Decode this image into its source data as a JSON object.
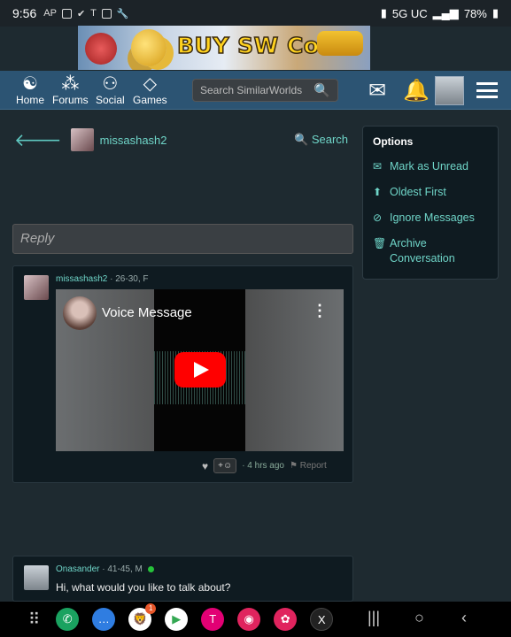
{
  "status_bar": {
    "time": "9:56",
    "network": "5G UC",
    "battery": "78%"
  },
  "banner": {
    "text": "BUY SW Coins"
  },
  "nav": {
    "items": [
      {
        "label": "Home"
      },
      {
        "label": "Forums"
      },
      {
        "label": "Social"
      },
      {
        "label": "Games"
      }
    ],
    "search_placeholder": "Search SimilarWorlds"
  },
  "conversation": {
    "partner_name": "missashash2",
    "search_label": "Search",
    "reply_placeholder": "Reply"
  },
  "options": {
    "title": "Options",
    "items": [
      {
        "label": "Mark as Unread",
        "icon": "envelope-icon"
      },
      {
        "label": "Oldest First",
        "icon": "arrow-up-icon"
      },
      {
        "label": "Ignore Messages",
        "icon": "eye-slash-icon"
      },
      {
        "label": "Archive Conversation",
        "icon": "trash-icon"
      }
    ]
  },
  "messages": [
    {
      "author": "missashash2",
      "meta": "· 26-30, F",
      "video_title": "Voice Message",
      "time": "· 4 hrs ago",
      "react_label": "+☺",
      "report_label": "Report"
    },
    {
      "author": "Onasander",
      "meta": "· 41-45, M",
      "text": "Hi, what would you like to talk about?",
      "online": true
    }
  ],
  "bottom_apps": [
    {
      "name": "phone",
      "color": "#1aa260"
    },
    {
      "name": "messages",
      "color": "#2f7de1"
    },
    {
      "name": "brave",
      "color": "#ffffff",
      "badge": "1"
    },
    {
      "name": "play-store",
      "color": "#ffffff"
    },
    {
      "name": "t-mobile",
      "color": "#e20074"
    },
    {
      "name": "camera",
      "color": "#e0245e"
    },
    {
      "name": "flower-app",
      "color": "#e0245e"
    },
    {
      "name": "x",
      "color": "#222222"
    }
  ]
}
